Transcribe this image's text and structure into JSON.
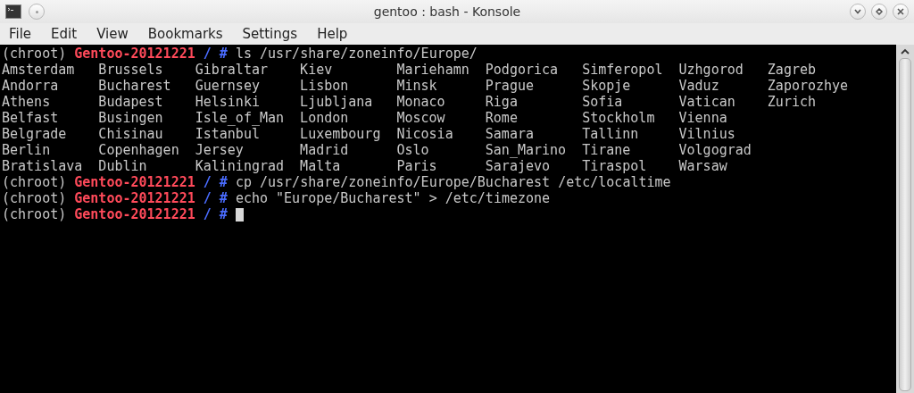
{
  "window": {
    "title": "gentoo : bash - Konsole"
  },
  "menu": [
    "File",
    "Edit",
    "View",
    "Bookmarks",
    "Settings",
    "Help"
  ],
  "terminal": {
    "lines": [
      {
        "kind": "prompt",
        "prefix": "(chroot)",
        "host": "Gentoo-20121221",
        "path": "/",
        "symbol": "#",
        "command": "ls /usr/share/zoneinfo/Europe/",
        "cursor": false
      },
      {
        "kind": "listing",
        "cells": [
          "Amsterdam",
          "Brussels",
          "Gibraltar",
          "Kiev",
          "Mariehamn",
          "Podgorica",
          "Simferopol",
          "Uzhgorod",
          "Zagreb"
        ]
      },
      {
        "kind": "listing",
        "cells": [
          "Andorra",
          "Bucharest",
          "Guernsey",
          "Lisbon",
          "Minsk",
          "Prague",
          "Skopje",
          "Vaduz",
          "Zaporozhye"
        ]
      },
      {
        "kind": "listing",
        "cells": [
          "Athens",
          "Budapest",
          "Helsinki",
          "Ljubljana",
          "Monaco",
          "Riga",
          "Sofia",
          "Vatican",
          "Zurich"
        ]
      },
      {
        "kind": "listing",
        "cells": [
          "Belfast",
          "Busingen",
          "Isle_of_Man",
          "London",
          "Moscow",
          "Rome",
          "Stockholm",
          "Vienna"
        ]
      },
      {
        "kind": "listing",
        "cells": [
          "Belgrade",
          "Chisinau",
          "Istanbul",
          "Luxembourg",
          "Nicosia",
          "Samara",
          "Tallinn",
          "Vilnius"
        ]
      },
      {
        "kind": "listing",
        "cells": [
          "Berlin",
          "Copenhagen",
          "Jersey",
          "Madrid",
          "Oslo",
          "San_Marino",
          "Tirane",
          "Volgograd"
        ]
      },
      {
        "kind": "listing",
        "cells": [
          "Bratislava",
          "Dublin",
          "Kaliningrad",
          "Malta",
          "Paris",
          "Sarajevo",
          "Tiraspol",
          "Warsaw"
        ]
      },
      {
        "kind": "prompt",
        "prefix": "(chroot)",
        "host": "Gentoo-20121221",
        "path": "/",
        "symbol": "#",
        "command": "cp /usr/share/zoneinfo/Europe/Bucharest /etc/localtime",
        "cursor": false
      },
      {
        "kind": "prompt",
        "prefix": "(chroot)",
        "host": "Gentoo-20121221",
        "path": "/",
        "symbol": "#",
        "command": "echo \"Europe/Bucharest\" > /etc/timezone",
        "cursor": false
      },
      {
        "kind": "prompt",
        "prefix": "(chroot)",
        "host": "Gentoo-20121221",
        "path": "/",
        "symbol": "#",
        "cursor": true
      }
    ]
  }
}
